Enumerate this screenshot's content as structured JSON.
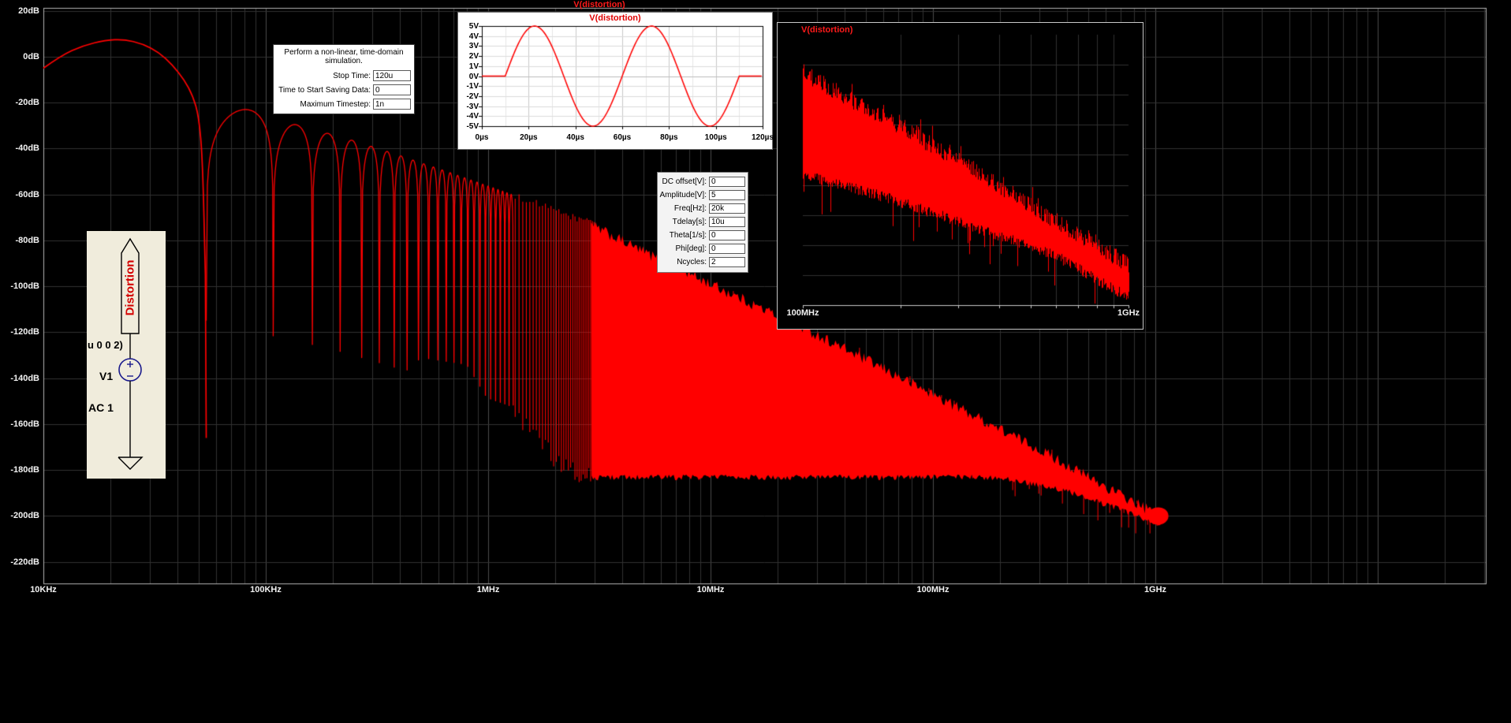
{
  "window": {
    "background": "#000000",
    "trace_color": "#ff0000"
  },
  "transient_dialog": {
    "title": "Perform a non-linear, time-domain simulation.",
    "rows": [
      {
        "label": "Stop Time:",
        "value": "120u"
      },
      {
        "label": "Time to Start Saving Data:",
        "value": "0"
      },
      {
        "label": "Maximum Timestep:",
        "value": "1n"
      }
    ]
  },
  "sine_dialog": {
    "rows": [
      {
        "label": "DC offset[V]:",
        "value": "0"
      },
      {
        "label": "Amplitude[V]:",
        "value": "5"
      },
      {
        "label": "Freq[Hz]:",
        "value": "20k"
      },
      {
        "label": "Tdelay[s]:",
        "value": "10u"
      },
      {
        "label": "Theta[1/s]:",
        "value": "0"
      },
      {
        "label": "Phi[deg]:",
        "value": "0"
      },
      {
        "label": "Ncycles:",
        "value": "2"
      }
    ]
  },
  "schematic": {
    "net_label": "Distortion",
    "clipped_text": "u 0 0 2)",
    "source_ref": "V1",
    "source_value": "AC 1",
    "symbol_color": "#1a1a8c",
    "background": "#f0ecdc"
  },
  "chart_data": [
    {
      "id": "main-spectrum",
      "type": "line",
      "title": "V(distortion)",
      "x_axis": {
        "scale": "log",
        "unit": "Hz",
        "min_hz": 10000,
        "max_hz": 31000000000,
        "tick_hz": [
          10000,
          100000,
          1000000,
          10000000,
          100000000,
          1000000000
        ],
        "tick_labels": [
          "10KHz",
          "100KHz",
          "1MHz",
          "10MHz",
          "100MHz",
          "1GHz"
        ]
      },
      "y_axis": {
        "unit": "dB",
        "max_db": 24,
        "min_db": -229,
        "grid_step_db": 20,
        "tick_db": [
          20,
          0,
          -20,
          -40,
          -60,
          -80,
          -100,
          -120,
          -140,
          -160,
          -180,
          -200,
          -220
        ],
        "tick_labels": [
          "20dB",
          "0dB",
          "-20dB",
          "-40dB",
          "-60dB",
          "-80dB",
          "-100dB",
          "-120dB",
          "-140dB",
          "-160dB",
          "-180dB",
          "-200dB",
          "-220dB"
        ]
      },
      "series": [
        {
          "name": "V(distortion)",
          "color": "#ff0000",
          "description": "FFT magnitude of a 2-cycle 20kHz, 5V sine burst (sinc lobes merging into a dense comb and noise wedge)",
          "main_lobe_db": [
            [
              10000,
              -5
            ],
            [
              12000,
              0.5
            ],
            [
              15000,
              4.8
            ],
            [
              19000,
              7.2
            ],
            [
              23000,
              7.6
            ],
            [
              28000,
              5.6
            ],
            [
              33000,
              2
            ],
            [
              38000,
              -3.5
            ],
            [
              43000,
              -10
            ],
            [
              47000,
              -17
            ],
            [
              50000,
              -26
            ],
            [
              52000,
              -45
            ],
            [
              53500,
              -95
            ]
          ],
          "null_spacing_hz": 54000,
          "lobe_peak_env_db": [
            [
              75000,
              -22
            ],
            [
              140000,
              -30
            ],
            [
              220000,
              -35
            ],
            [
              400000,
              -43
            ],
            [
              700000,
              -51
            ],
            [
              1200000,
              -59
            ],
            [
              2600000,
              -71
            ]
          ],
          "notch_floor_db": [
            [
              54000,
              -166
            ],
            [
              150000,
              -166
            ],
            [
              300000,
              -150
            ],
            [
              500000,
              -131
            ],
            [
              800000,
              -134
            ],
            [
              1100000,
              -156
            ],
            [
              1600000,
              -161
            ],
            [
              2000000,
              -177
            ],
            [
              2600000,
              -182
            ]
          ],
          "mass_top_db": [
            [
              2600000,
              -71
            ],
            [
              5000000,
              -85
            ],
            [
              10000000,
              -99
            ],
            [
              30000000,
              -121
            ],
            [
              100000000,
              -147
            ],
            [
              300000000,
              -171
            ],
            [
              700000000,
              -191
            ],
            [
              1000000000,
              -199
            ],
            [
              1080000000,
              -204
            ]
          ],
          "mass_bottom_db": [
            [
              2600000,
              -182
            ],
            [
              200000000,
              -182
            ],
            [
              400000000,
              -188
            ],
            [
              700000000,
              -196
            ],
            [
              1000000000,
              -202
            ],
            [
              1080000000,
              -204
            ]
          ]
        }
      ]
    },
    {
      "id": "time-waveform",
      "type": "line",
      "title": "V(distortion)",
      "x_axis": {
        "unit": "µs",
        "min": 0,
        "max": 120,
        "step": 20,
        "tick_labels": [
          "0µs",
          "20µs",
          "40µs",
          "60µs",
          "80µs",
          "100µs",
          "120µs"
        ]
      },
      "y_axis": {
        "unit": "V",
        "min": -5,
        "max": 5,
        "step": 1,
        "tick_labels": [
          "5V",
          "4V",
          "3V",
          "2V",
          "1V",
          "0V",
          "-1V",
          "-2V",
          "-3V",
          "-4V",
          "-5V"
        ]
      },
      "series": [
        {
          "name": "V(distortion)",
          "color": "#ff0000",
          "kind": "sine_burst",
          "dc_offset_v": 0,
          "amplitude_v": 5,
          "freq_hz": 20000,
          "tdelay_us": 10,
          "ncycles": 2
        }
      ]
    },
    {
      "id": "fft-zoom",
      "type": "line",
      "title": "V(distortion)",
      "x_axis": {
        "scale": "log",
        "unit": "Hz",
        "min_hz": 100000000,
        "max_hz": 1000000000,
        "tick_labels": [
          "100MHz",
          "1GHz"
        ]
      },
      "y_axis": {
        "unit": "dB",
        "grid_rows": 9
      },
      "band": {
        "color": "#ff0000",
        "top_frac": [
          [
            0,
            0.14
          ],
          [
            0.25,
            0.31
          ],
          [
            0.5,
            0.48
          ],
          [
            0.75,
            0.67
          ],
          [
            0.9,
            0.78
          ],
          [
            1,
            0.85
          ]
        ],
        "bottom_frac": [
          [
            0,
            0.52
          ],
          [
            0.25,
            0.6
          ],
          [
            0.5,
            0.7
          ],
          [
            0.78,
            0.82
          ],
          [
            0.92,
            0.92
          ],
          [
            1,
            0.97
          ]
        ]
      }
    }
  ]
}
